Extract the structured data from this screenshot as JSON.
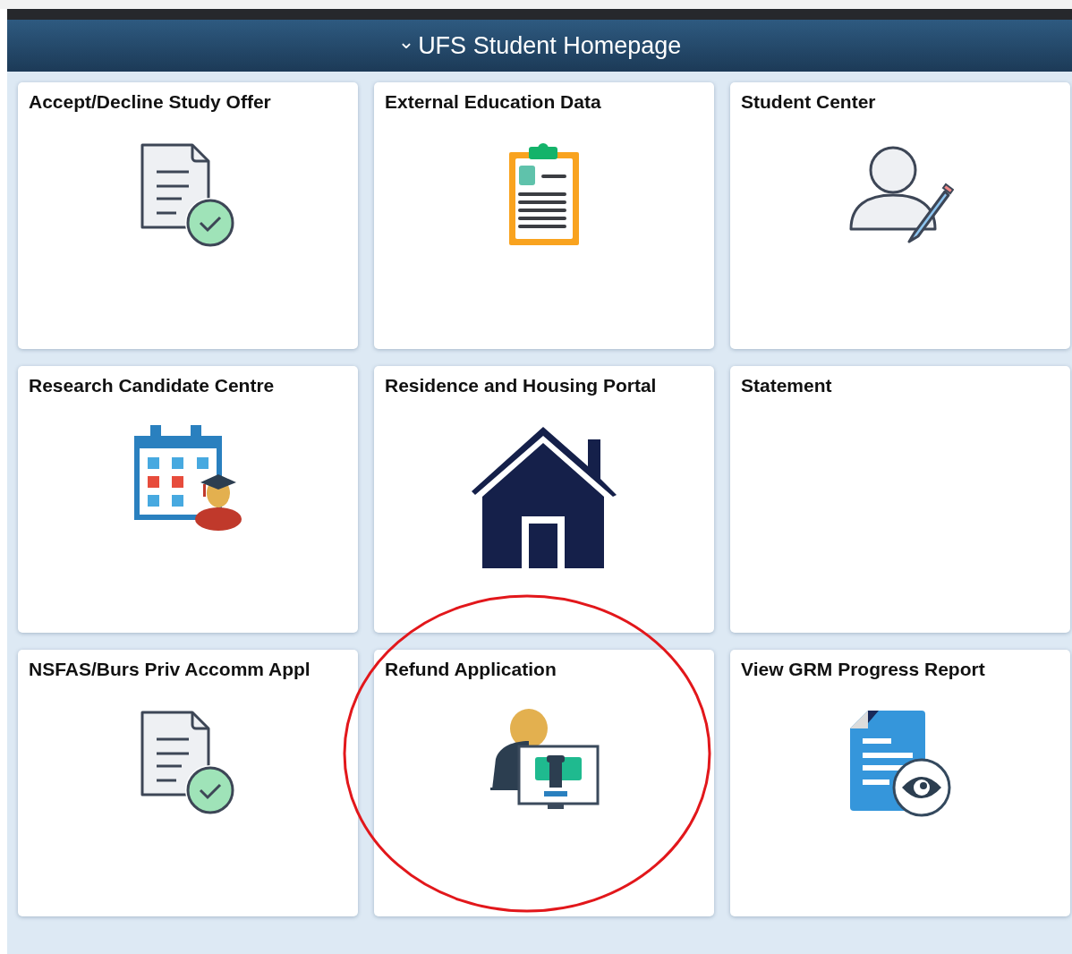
{
  "header": {
    "title": "UFS Student Homepage",
    "caret": "⌄"
  },
  "tiles": [
    {
      "title": "Accept/Decline Study Offer",
      "kind": "doc-check",
      "circled": false
    },
    {
      "title": "External Education Data",
      "kind": "clipboard",
      "circled": false
    },
    {
      "title": "Student Center",
      "kind": "user-edit",
      "circled": false
    },
    {
      "title": "Research Candidate Centre",
      "kind": "calendar-grad",
      "circled": false
    },
    {
      "title": "Residence and Housing Portal",
      "kind": "house",
      "circled": false
    },
    {
      "title": "Statement",
      "kind": "plain",
      "circled": false
    },
    {
      "title": "NSFAS/Burs Priv Accomm Appl",
      "kind": "doc-check",
      "circled": false
    },
    {
      "title": "Refund Application",
      "kind": "refund",
      "circled": true
    },
    {
      "title": "View GRM Progress Report",
      "kind": "doc-eye",
      "circled": false
    }
  ]
}
